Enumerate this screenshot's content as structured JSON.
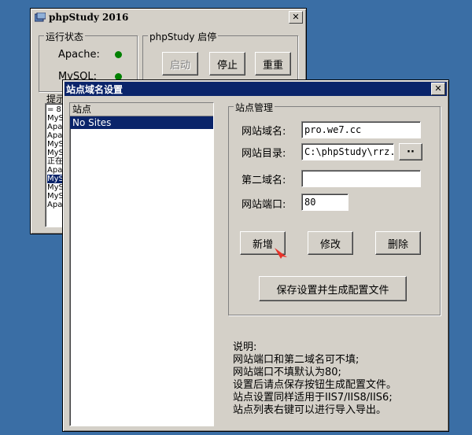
{
  "main_window": {
    "title": "phpStudy 2016",
    "status_group": {
      "caption": "运行状态",
      "apache_label": "Apache:",
      "mysql_label": "MySQL:"
    },
    "control_group": {
      "caption": "phpStudy 启停",
      "start": "启动",
      "stop": "停止",
      "restart": "重重"
    },
    "hint_caption": "提示",
    "log_lines": [
      "= 8",
      "MyS",
      "Apa",
      "Apa",
      "MyS",
      "MyS",
      "正在",
      "Apa",
      "MyS",
      "MyS",
      "MyS",
      "Apa"
    ]
  },
  "dialog": {
    "title": "站点域名设置",
    "list": {
      "header": "站点",
      "items": [
        "No Sites"
      ]
    },
    "site_group": {
      "caption": "站点管理"
    },
    "domain_label": "网站域名:",
    "domain_value": "pro.we7.cc",
    "dir_label": "网站目录:",
    "dir_value": "C:\\phpStudy\\rrz.",
    "browse_label": "··",
    "second_domain_label": "第二域名:",
    "second_domain_value": "",
    "port_label": "网站端口:",
    "port_value": "80",
    "add_button": "新增",
    "modify_button": "修改",
    "delete_button": "删除",
    "save_button": "保存设置并生成配置文件",
    "notes": [
      "说明:",
      "网站端口和第二域名可不填;",
      "网站端口不填默认为80;",
      "设置后请点保存按钮生成配置文件。",
      "站点设置同样适用于IIS7/IIS8/IIS6;",
      "站点列表右键可以进行导入导出。"
    ]
  },
  "colors": {
    "desktop": "#3a6ea5",
    "title_active": "#0a246a",
    "selection": "#0a246a",
    "running": "#008000",
    "cursor_arrow": "#e8332a"
  }
}
